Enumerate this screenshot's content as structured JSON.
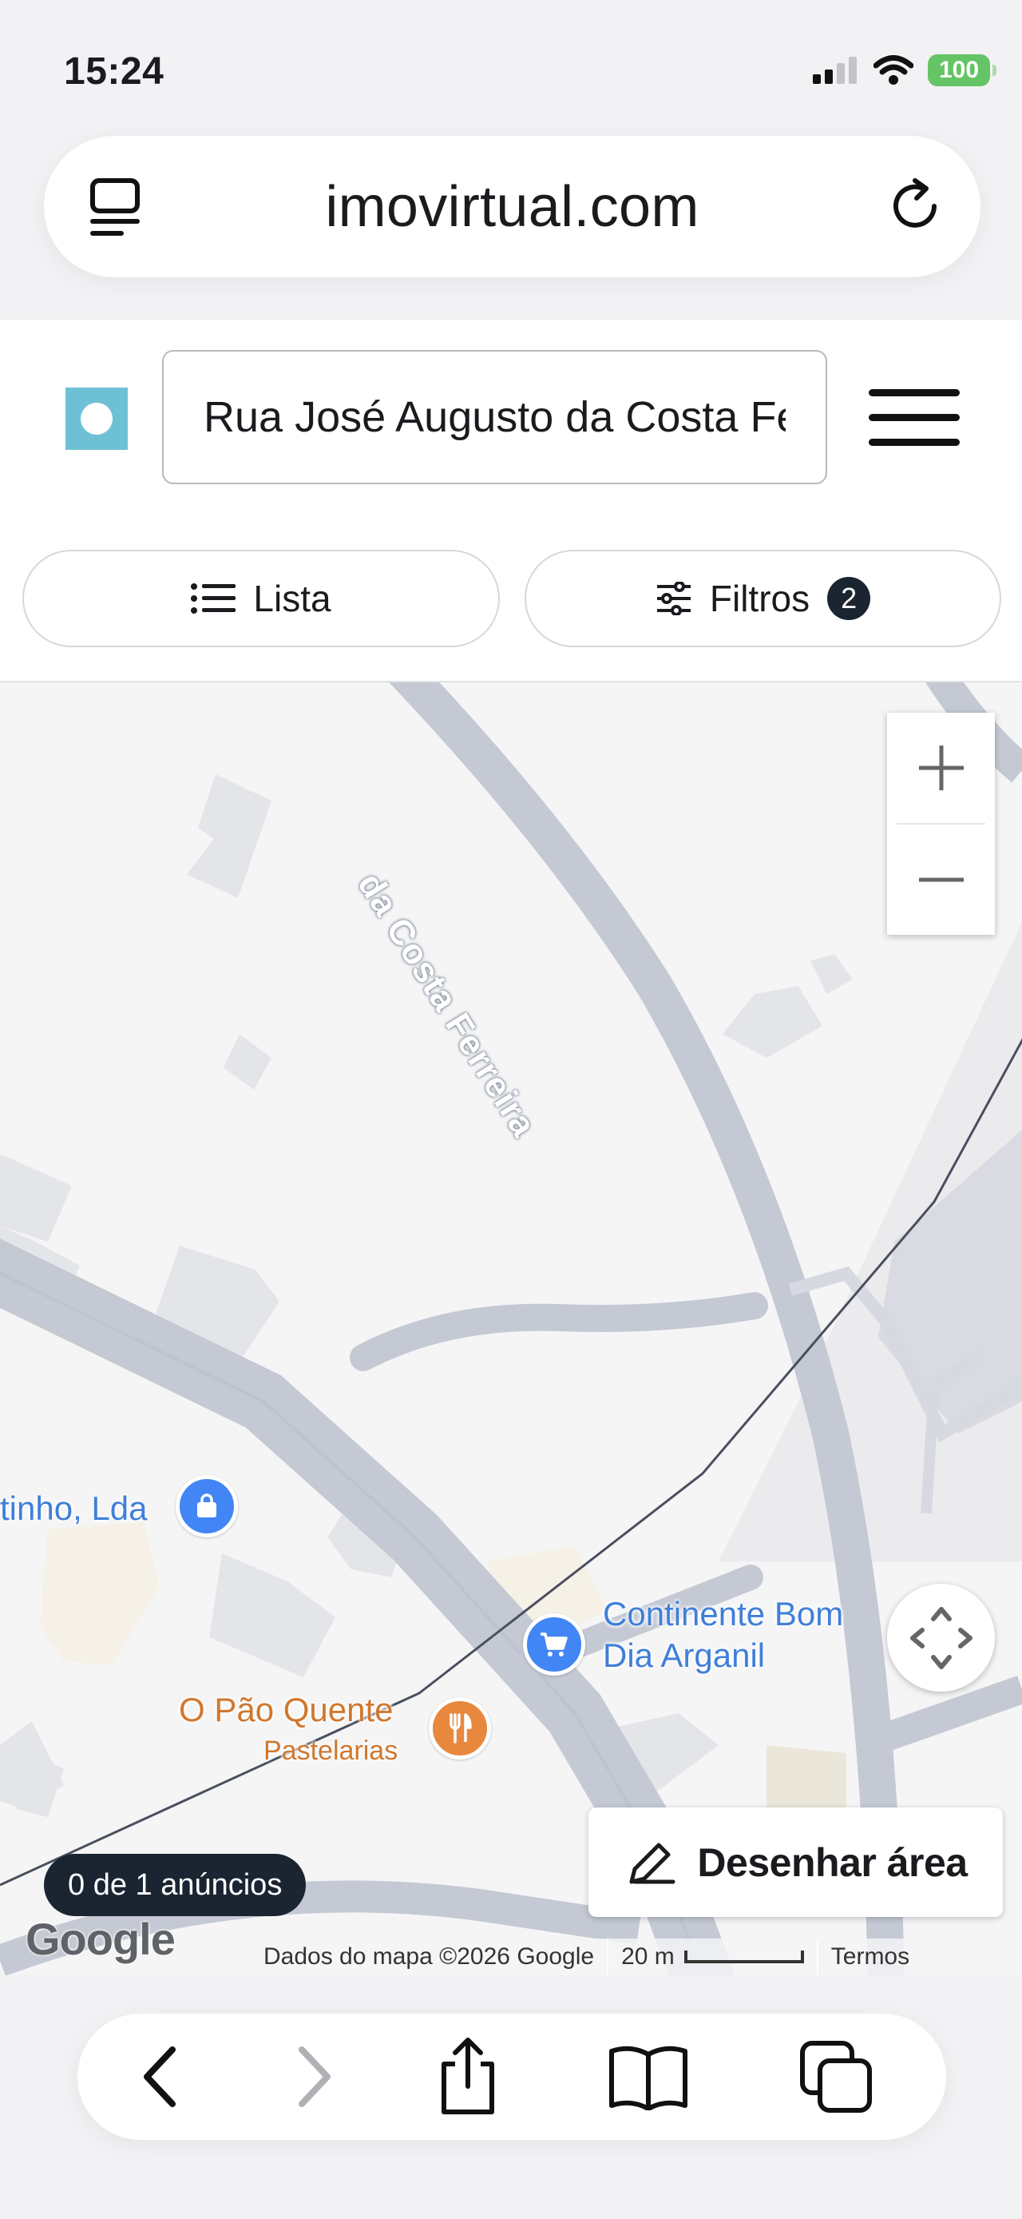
{
  "status_bar": {
    "time": "15:24",
    "battery": "100"
  },
  "browser": {
    "url": "imovirtual.com"
  },
  "header": {
    "search_value": "Rua José Augusto da Costa Ferreira"
  },
  "view_toggle": {
    "list_label": "Lista",
    "filters_label": "Filtros",
    "filters_count": "2"
  },
  "map": {
    "street_name": "da Costa Ferreira",
    "pois": [
      {
        "name": "tinho, Lda",
        "category": "shopping",
        "icon": "shopping-bag-icon",
        "color": "#4285f4"
      },
      {
        "name_line1": "Continente Bom",
        "name_line2": "Dia Arganil",
        "category": "supermarket",
        "icon": "cart-icon",
        "color": "#4285f4"
      },
      {
        "name": "O Pão Quente",
        "subtitle": "Pastelarias",
        "category": "restaurant",
        "icon": "fork-knife-icon",
        "color": "#e8883e"
      }
    ],
    "results_chip": "0 de 1 anúncios",
    "draw_area_label": "Desenhar área",
    "google_logo": "Google",
    "attribution": "Dados do mapa ©2026 Google",
    "scale": "20 m",
    "terms": "Termos"
  },
  "colors": {
    "accent_logo": "#6ec1d4",
    "badge_bg": "#1b2431",
    "poi_blue": "#3f7fd9",
    "poi_orange": "#d0772e"
  }
}
